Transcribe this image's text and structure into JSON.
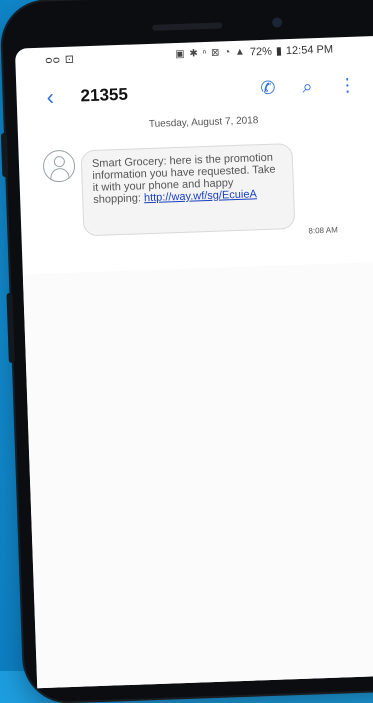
{
  "status_bar": {
    "left_icons": "ᴑᴑ ⊡",
    "right_icons": "▣ ✱ ⁿ ⊠ ◔ ▲",
    "battery": "72%",
    "time": "12:54 PM"
  },
  "header": {
    "title": "21355",
    "back_icon": "‹",
    "call_icon": "✆",
    "search_icon": "⌕",
    "more_icon": "⋮"
  },
  "conversation": {
    "date": "Tuesday, August 7, 2018",
    "message": {
      "text": "Smart Grocery: here is the promotion information you have requested. Take it with your phone and happy shopping: ",
      "link": "http://way.wf/sg/EcuieA",
      "time": "8:08 AM"
    }
  },
  "colors": {
    "accent": "#2f6fd9",
    "background": "#1d9ee0",
    "link": "#1a3fc2"
  }
}
